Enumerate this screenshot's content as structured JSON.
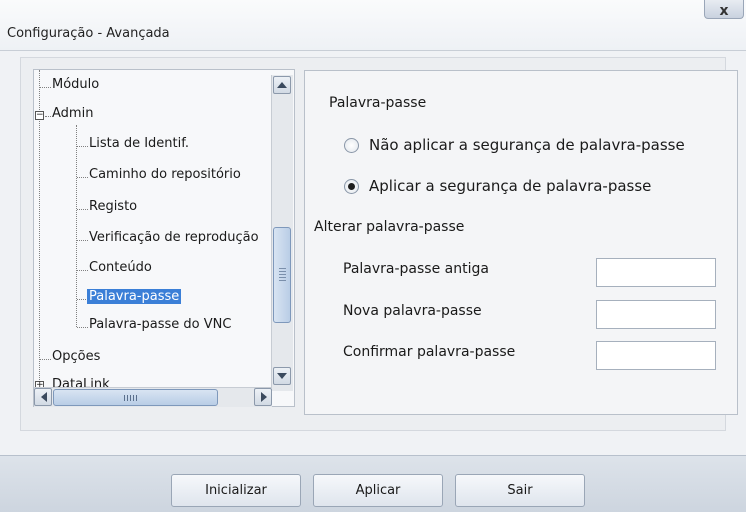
{
  "window": {
    "title": "Configuração - Avançada",
    "close_glyph": "x"
  },
  "tree": {
    "items": [
      {
        "label": "Módulo"
      },
      {
        "label": "Admin",
        "expander": "−"
      },
      {
        "label": "Lista de Identif."
      },
      {
        "label": "Caminho do repositório"
      },
      {
        "label": "Registo"
      },
      {
        "label": "Verificação de reprodução"
      },
      {
        "label": "Conteúdo"
      },
      {
        "label": "Palavra-passe",
        "selected": true
      },
      {
        "label": "Palavra-passe do VNC"
      },
      {
        "label": "Opções"
      },
      {
        "label": "DataLink",
        "expander": "+"
      }
    ]
  },
  "panel": {
    "section_title": "Palavra-passe",
    "radio_no": "Não aplicar a segurança de palavra-passe",
    "radio_yes": "Aplicar a segurança de palavra-passe",
    "selected_option": "radio_yes",
    "change_title": "Alterar palavra-passe",
    "old_label": "Palavra-passe antiga",
    "new_label": "Nova palavra-passe",
    "confirm_label": "Confirmar palavra-passe",
    "old_value": "",
    "new_value": "",
    "confirm_value": ""
  },
  "buttons": {
    "init": "Inicializar",
    "apply": "Aplicar",
    "exit": "Sair"
  }
}
